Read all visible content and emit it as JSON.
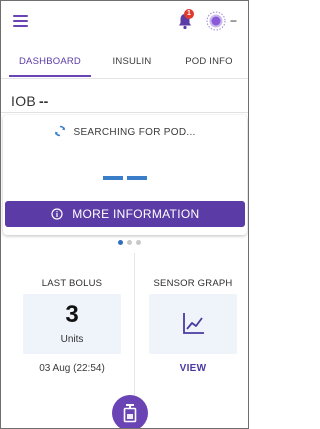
{
  "header": {
    "menu_icon": "hamburger-menu-icon",
    "notification_icon": "bell-icon",
    "notification_count": "1",
    "pod_status_icon": "pod-status-icon",
    "status_indicator": "--"
  },
  "tabs": [
    {
      "label": "DASHBOARD",
      "active": true
    },
    {
      "label": "INSULIN",
      "active": false
    },
    {
      "label": "POD INFO",
      "active": false
    }
  ],
  "iob": {
    "label": "IOB",
    "value": "--"
  },
  "pod_card": {
    "status_icon": "sync-icon",
    "status_text": "SEARCHING FOR POD...",
    "more_info_icon": "info-icon",
    "more_info_label": "MORE INFORMATION"
  },
  "pager": {
    "pages": 3,
    "active_index": 0
  },
  "last_bolus": {
    "title": "LAST BOLUS",
    "value": "3",
    "unit": "Units",
    "timestamp": "03 Aug (22:54)"
  },
  "sensor_graph": {
    "title": "SENSOR GRAPH",
    "icon": "line-chart-icon",
    "link_label": "VIEW"
  },
  "fab": {
    "icon": "bolus-icon"
  },
  "colors": {
    "primary": "#5b3ba6",
    "accent_blue": "#3a7dc9",
    "badge_red": "#e03a2f",
    "panel_bg": "#eef4f9"
  }
}
